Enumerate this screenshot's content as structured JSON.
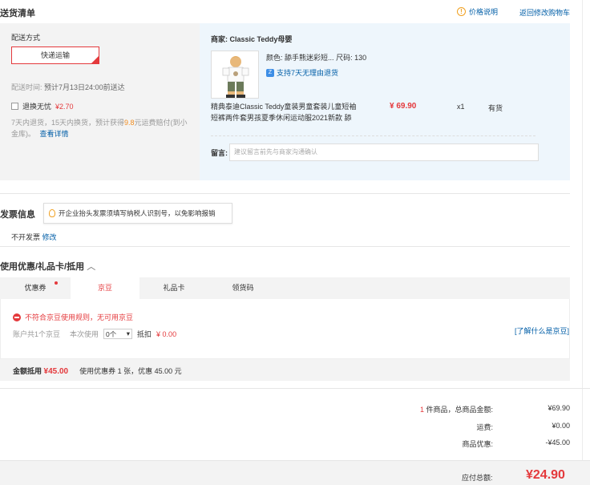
{
  "section_title": "送货清单",
  "header_links": {
    "price_explain": "价格说明",
    "back_to_cart": "返回修改购物车"
  },
  "shipping": {
    "label": "配送方式",
    "method": "快递运输",
    "delivery_time_label": "配送时间:",
    "delivery_time_value": "预计7月13日24:00前送达",
    "return_option": "退换无忧",
    "return_price": "¥2.70",
    "return_desc_1": "7天内退货，15天内换货，预计获得",
    "return_desc_highlight": "9.8",
    "return_desc_2": "元运费赔付(到小金库)。",
    "return_detail_link": "查看详情"
  },
  "merchant": {
    "label": "商家:",
    "name": "Classic Teddy母婴",
    "attr_color_label": "颜色:",
    "attr_color": "舔手熊迷彩短...",
    "attr_size_label": "尺码:",
    "attr_size": "130",
    "support": "支持7天无理由退货",
    "support_icon_text": "Z",
    "product_name": "精典泰迪Classic Teddy童装男童套装儿童短袖短裤两件套男孩夏季休闲运动服2021新款 舔",
    "price": "¥ 69.90",
    "qty": "x1",
    "stock": "有货",
    "message_label": "留言:",
    "message_placeholder": "建议留言前先与商家沟通确认"
  },
  "invoice": {
    "title": "发票信息",
    "tip": "开企业抬头发票须填写纳税人识别号，以免影响报销",
    "value": "不开发票",
    "edit": "修改"
  },
  "coupons": {
    "title": "使用优惠/礼品卡/抵用",
    "tabs": [
      "优惠券",
      "京豆",
      "礼品卡",
      "领货码"
    ],
    "error": "不符合京豆使用规则，无可用京豆",
    "account_beans": "账户共1个京豆",
    "use_label": "本次使用",
    "use_value": "0个",
    "deduct_label": "抵扣",
    "deduct_value": "¥ 0.00",
    "learn_link": "[了解什么是京豆]",
    "summary_label": "金额抵用",
    "summary_amount": "¥45.00",
    "summary_desc": "使用优惠券 1 张，优惠 45.00 元"
  },
  "totals": {
    "count": "1",
    "items_label": "件商品，总商品金额:",
    "items_value": "¥69.90",
    "shipping_label": "运费:",
    "shipping_value": "¥0.00",
    "discount_label": "商品优惠:",
    "discount_value": "-¥45.00",
    "grand_label": "应付总额:",
    "grand_value": "¥24.90"
  },
  "colors": {
    "accent": "#e4393c",
    "link": "#005ea7",
    "panel_gray": "#f3f3f3",
    "panel_blue": "#eef6fc"
  }
}
